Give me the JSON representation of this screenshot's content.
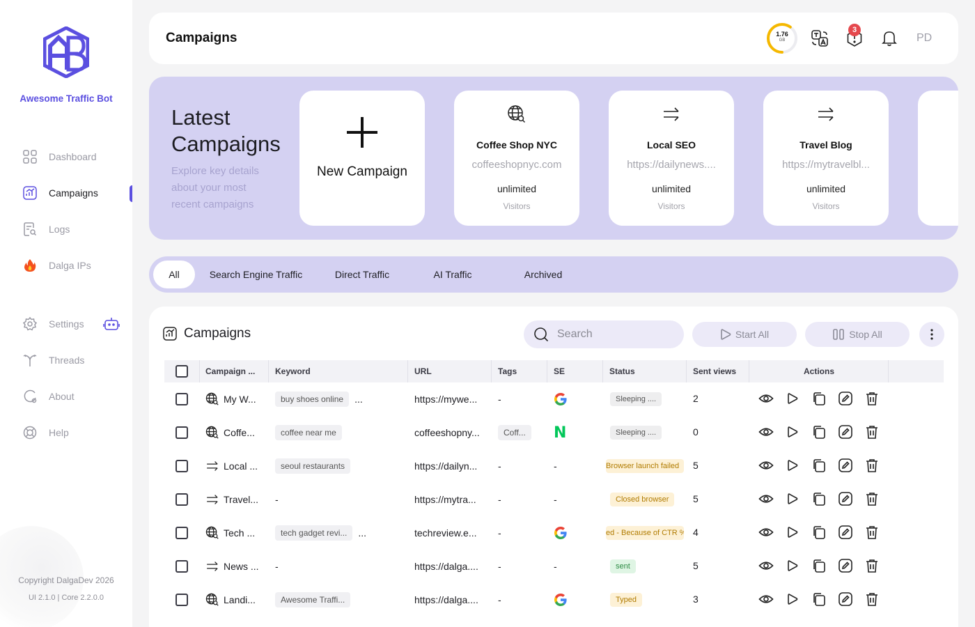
{
  "sidebar": {
    "brand": "Awesome Traffic Bot",
    "items": [
      {
        "label": "Dashboard",
        "icon": "dashboard-grid-icon"
      },
      {
        "label": "Campaigns",
        "icon": "campaigns-chart-icon"
      },
      {
        "label": "Logs",
        "icon": "logs-search-icon"
      },
      {
        "label": "Dalga IPs",
        "icon": "fire-icon"
      },
      {
        "label": "Settings",
        "icon": "gear-icon"
      },
      {
        "label": "Threads",
        "icon": "threads-fork-icon"
      },
      {
        "label": "About",
        "icon": "about-icon"
      },
      {
        "label": "Help",
        "icon": "lifebuoy-icon"
      }
    ],
    "active_item": "Campaigns",
    "copyright": "Copyright DalgaDev 2026",
    "version": "UI 2.1.0 | Core 2.2.0.0"
  },
  "header": {
    "title": "Campaigns",
    "disk_value": "1.76",
    "disk_unit": "GB",
    "disk_usage_fraction": 0.6,
    "notification_count": "3",
    "avatar_initials": "PD"
  },
  "latest": {
    "title": "Latest Campaigns",
    "subtitle": "Explore key details about your most recent campaigns",
    "new_campaign_label": "New Campaign",
    "cards": [
      {
        "name": "Coffee Shop NYC",
        "url": "coffeeshopnyc.com",
        "visitors": "unlimited",
        "visitors_label": "Visitors",
        "icon": "globe-search-icon"
      },
      {
        "name": "Local SEO",
        "url": "https://dailynews....",
        "visitors": "unlimited",
        "visitors_label": "Visitors",
        "icon": "direct-arrows-icon"
      },
      {
        "name": "Travel Blog",
        "url": "https://mytravelbl...",
        "visitors": "unlimited",
        "visitors_label": "Visitors",
        "icon": "direct-arrows-icon"
      }
    ]
  },
  "tabs": [
    "All",
    "Search Engine Traffic",
    "Direct Traffic",
    "AI Traffic",
    "Archived"
  ],
  "table": {
    "title": "Campaigns",
    "search_placeholder": "Search",
    "start_all": "Start All",
    "stop_all": "Stop All",
    "columns": [
      "Campaign ...",
      "Keyword",
      "URL",
      "Tags",
      "SE",
      "Status",
      "Sent views",
      "Actions"
    ],
    "rows": [
      {
        "type_icon": "globe-search-icon",
        "name": "My W...",
        "keyword": "buy shoes online",
        "more": "...",
        "url": "https://mywe...",
        "tags": "-",
        "se": "google",
        "se_text": "",
        "status": "Sleeping ....",
        "status_kind": "sleep",
        "sent": "2"
      },
      {
        "type_icon": "globe-search-icon",
        "name": "Coffe...",
        "keyword": "coffee near me",
        "more": "",
        "url": "coffeeshopny...",
        "tags": "Coff...",
        "se": "naver",
        "se_text": "N",
        "status": "Sleeping ....",
        "status_kind": "sleep",
        "sent": "0"
      },
      {
        "type_icon": "direct-arrows-icon",
        "name": "Local ...",
        "keyword": "seoul restaurants",
        "more": "",
        "url": "https://dailyn...",
        "tags": "-",
        "se": "none",
        "se_text": "-",
        "status": "Browser launch failed",
        "status_kind": "fail",
        "sent": "5"
      },
      {
        "type_icon": "direct-arrows-icon",
        "name": "Travel...",
        "keyword": "-",
        "more": "",
        "url": "https://mytra...",
        "tags": "-",
        "se": "none",
        "se_text": "-",
        "status": "Closed browser",
        "status_kind": "fail",
        "sent": "5"
      },
      {
        "type_icon": "globe-search-icon",
        "name": "Tech ...",
        "keyword": "tech gadget revi...",
        "more": "...",
        "url": "techreview.e...",
        "tags": "-",
        "se": "google",
        "se_text": "",
        "status": "ed - Because of CTR % se",
        "status_kind": "fail",
        "sent": "4"
      },
      {
        "type_icon": "direct-arrows-icon",
        "name": "News ...",
        "keyword": "-",
        "more": "",
        "url": "https://dalga....",
        "tags": "-",
        "se": "none",
        "se_text": "-",
        "status": "sent",
        "status_kind": "sent",
        "sent": "5"
      },
      {
        "type_icon": "globe-search-icon",
        "name": "Landi...",
        "keyword": "Awesome Traffi...",
        "more": "",
        "url": "https://dalga....",
        "tags": "-",
        "se": "google",
        "se_text": "",
        "status": "Typed",
        "status_kind": "fail",
        "sent": "3"
      }
    ],
    "row_actions": [
      "view-eye-icon",
      "play-icon",
      "copy-icon",
      "edit-icon",
      "delete-trash-icon"
    ]
  },
  "colors": {
    "accent": "#5b4fe0",
    "panel_lavender": "#d4d1f2",
    "naver_green": "#03c75a",
    "badge_red": "#e5484d",
    "disk_ring": "#f5b800"
  }
}
